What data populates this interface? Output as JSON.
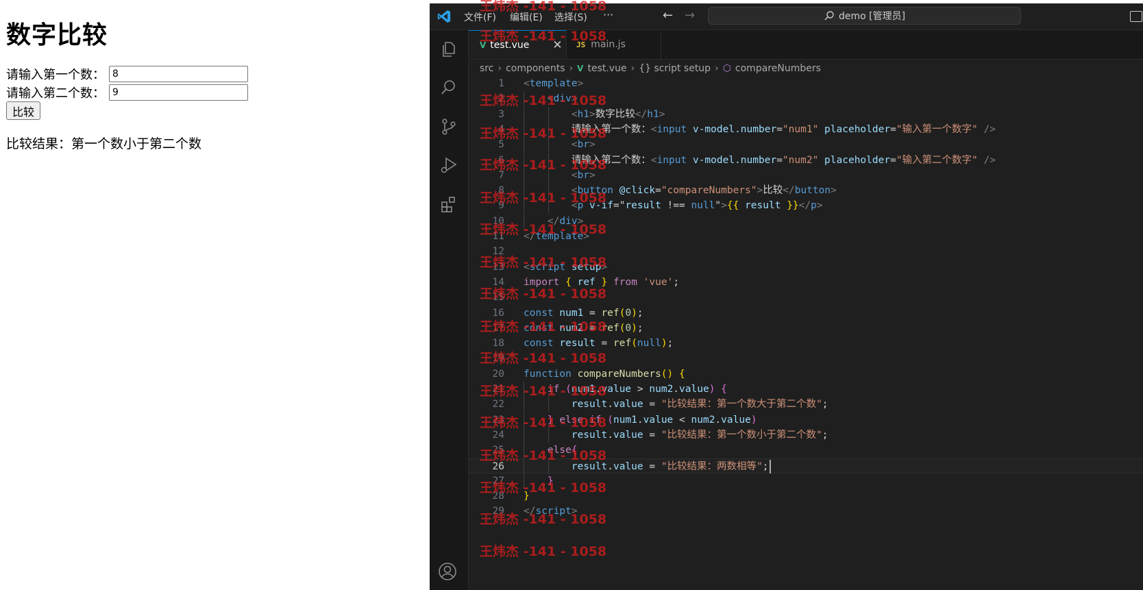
{
  "browser": {
    "heading": "数字比较",
    "input1_label": "请输入第一个数：",
    "input1_value": "8",
    "input2_label": "请输入第二个数：",
    "input2_value": "9",
    "button_label": "比较",
    "result": "比较结果：第一个数小于第二个数"
  },
  "vscode": {
    "menu": [
      "文件(F)",
      "编辑(E)",
      "选择(S)",
      "···"
    ],
    "command_center": "demo [管理员]",
    "tabs": [
      {
        "label": "test.vue",
        "icon": "vue-icon",
        "active": true
      },
      {
        "label": "main.js",
        "icon": "js-icon",
        "active": false
      }
    ],
    "breadcrumb": [
      "src",
      "components",
      "test.vue",
      "{} script setup",
      "compareNumbers"
    ],
    "current_line": 26,
    "watermark": "王炜杰 -141 - 1058",
    "accent_color": "#0078d4"
  },
  "code_lines": [
    [
      [
        "t-punc",
        "<"
      ],
      [
        "t-tag",
        "template"
      ],
      [
        "t-punc",
        ">"
      ]
    ],
    [
      [
        "",
        "    "
      ],
      [
        "t-punc",
        "<"
      ],
      [
        "t-tag",
        "div"
      ],
      [
        "t-punc",
        ">"
      ]
    ],
    [
      [
        "",
        "        "
      ],
      [
        "t-punc",
        "<"
      ],
      [
        "t-tag",
        "h1"
      ],
      [
        "t-punc",
        ">"
      ],
      [
        "t-txt",
        "数字比较"
      ],
      [
        "t-punc",
        "</"
      ],
      [
        "t-tag",
        "h1"
      ],
      [
        "t-punc",
        ">"
      ]
    ],
    [
      [
        "",
        "        "
      ],
      [
        "t-txt",
        "请输入第一个数："
      ],
      [
        "t-punc",
        "<"
      ],
      [
        "t-tag",
        "input"
      ],
      [
        "t-txt",
        " "
      ],
      [
        "t-attr",
        "v-model.number"
      ],
      [
        "t-txt",
        "="
      ],
      [
        "t-str",
        "\"num1\""
      ],
      [
        "t-txt",
        " "
      ],
      [
        "t-attr",
        "placeholder"
      ],
      [
        "t-txt",
        "="
      ],
      [
        "t-str",
        "\"输入第一个数字\""
      ],
      [
        "t-txt",
        " "
      ],
      [
        "t-punc",
        "/>"
      ]
    ],
    [
      [
        "",
        "        "
      ],
      [
        "t-punc",
        "<"
      ],
      [
        "t-tag",
        "br"
      ],
      [
        "t-punc",
        ">"
      ]
    ],
    [
      [
        "",
        "        "
      ],
      [
        "t-txt",
        "请输入第二个数："
      ],
      [
        "t-punc",
        "<"
      ],
      [
        "t-tag",
        "input"
      ],
      [
        "t-txt",
        " "
      ],
      [
        "t-attr",
        "v-model.number"
      ],
      [
        "t-txt",
        "="
      ],
      [
        "t-str",
        "\"num2\""
      ],
      [
        "t-txt",
        " "
      ],
      [
        "t-attr",
        "placeholder"
      ],
      [
        "t-txt",
        "="
      ],
      [
        "t-str",
        "\"输入第二个数字\""
      ],
      [
        "t-txt",
        " "
      ],
      [
        "t-punc",
        "/>"
      ]
    ],
    [
      [
        "",
        "        "
      ],
      [
        "t-punc",
        "<"
      ],
      [
        "t-tag",
        "br"
      ],
      [
        "t-punc",
        ">"
      ]
    ],
    [
      [
        "",
        "        "
      ],
      [
        "t-punc",
        "<"
      ],
      [
        "t-tag",
        "button"
      ],
      [
        "t-txt",
        " "
      ],
      [
        "t-attr",
        "@click"
      ],
      [
        "t-txt",
        "="
      ],
      [
        "t-str",
        "\"compareNumbers\""
      ],
      [
        "t-punc",
        ">"
      ],
      [
        "t-txt",
        "比较"
      ],
      [
        "t-punc",
        "</"
      ],
      [
        "t-tag",
        "button"
      ],
      [
        "t-punc",
        ">"
      ]
    ],
    [
      [
        "",
        "        "
      ],
      [
        "t-punc",
        "<"
      ],
      [
        "t-tag",
        "p"
      ],
      [
        "t-txt",
        " "
      ],
      [
        "t-attr",
        "v-if"
      ],
      [
        "t-txt",
        "="
      ],
      [
        "t-txt",
        "\""
      ],
      [
        "t-var",
        "result"
      ],
      [
        "t-txt",
        " !== "
      ],
      [
        "t-kw",
        "null"
      ],
      [
        "t-txt",
        "\""
      ],
      [
        "t-punc",
        ">"
      ],
      [
        "t-b1",
        "{{"
      ],
      [
        "t-txt",
        " "
      ],
      [
        "t-var",
        "result"
      ],
      [
        "t-txt",
        " "
      ],
      [
        "t-b1",
        "}}"
      ],
      [
        "t-punc",
        "</"
      ],
      [
        "t-tag",
        "p"
      ],
      [
        "t-punc",
        ">"
      ]
    ],
    [
      [
        "",
        "    "
      ],
      [
        "t-punc",
        "</"
      ],
      [
        "t-tag",
        "div"
      ],
      [
        "t-punc",
        ">"
      ]
    ],
    [
      [
        "t-punc",
        "</"
      ],
      [
        "t-tag",
        "template"
      ],
      [
        "t-punc",
        ">"
      ]
    ],
    [],
    [
      [
        "t-punc",
        "<"
      ],
      [
        "t-tag",
        "script"
      ],
      [
        "t-txt",
        " "
      ],
      [
        "t-attr",
        "setup"
      ],
      [
        "t-punc",
        ">"
      ]
    ],
    [
      [
        "t-ctrl",
        "import"
      ],
      [
        "t-txt",
        " "
      ],
      [
        "t-b1",
        "{"
      ],
      [
        "t-txt",
        " "
      ],
      [
        "t-var",
        "ref"
      ],
      [
        "t-txt",
        " "
      ],
      [
        "t-b1",
        "}"
      ],
      [
        "t-txt",
        " "
      ],
      [
        "t-ctrl",
        "from"
      ],
      [
        "t-txt",
        " "
      ],
      [
        "t-str",
        "'vue'"
      ],
      [
        "t-txt",
        ";"
      ]
    ],
    [],
    [
      [
        "t-kw",
        "const"
      ],
      [
        "t-txt",
        " "
      ],
      [
        "t-var",
        "num1"
      ],
      [
        "t-txt",
        " = "
      ],
      [
        "t-fn",
        "ref"
      ],
      [
        "t-b1",
        "("
      ],
      [
        "t-num",
        "0"
      ],
      [
        "t-b1",
        ")"
      ],
      [
        "t-txt",
        ";"
      ]
    ],
    [
      [
        "t-kw",
        "const"
      ],
      [
        "t-txt",
        " "
      ],
      [
        "t-var",
        "num2"
      ],
      [
        "t-txt",
        " = "
      ],
      [
        "t-fn",
        "ref"
      ],
      [
        "t-b1",
        "("
      ],
      [
        "t-num",
        "0"
      ],
      [
        "t-b1",
        ")"
      ],
      [
        "t-txt",
        ";"
      ]
    ],
    [
      [
        "t-kw",
        "const"
      ],
      [
        "t-txt",
        " "
      ],
      [
        "t-var",
        "result"
      ],
      [
        "t-txt",
        " = "
      ],
      [
        "t-fn",
        "ref"
      ],
      [
        "t-b1",
        "("
      ],
      [
        "t-kw",
        "null"
      ],
      [
        "t-b1",
        ")"
      ],
      [
        "t-txt",
        ";"
      ]
    ],
    [],
    [
      [
        "t-kw",
        "function"
      ],
      [
        "t-txt",
        " "
      ],
      [
        "t-fn",
        "compareNumbers"
      ],
      [
        "t-b1",
        "()"
      ],
      [
        "t-txt",
        " "
      ],
      [
        "t-b1",
        "{"
      ]
    ],
    [
      [
        "",
        "    "
      ],
      [
        "t-ctrl",
        "if"
      ],
      [
        "t-txt",
        " "
      ],
      [
        "t-b2",
        "("
      ],
      [
        "t-var",
        "num1"
      ],
      [
        "t-txt",
        "."
      ],
      [
        "t-var",
        "value"
      ],
      [
        "t-txt",
        " > "
      ],
      [
        "t-var",
        "num2"
      ],
      [
        "t-txt",
        "."
      ],
      [
        "t-var",
        "value"
      ],
      [
        "t-b2",
        ")"
      ],
      [
        "t-txt",
        " "
      ],
      [
        "t-b2",
        "{"
      ]
    ],
    [
      [
        "",
        "        "
      ],
      [
        "t-var",
        "result"
      ],
      [
        "t-txt",
        "."
      ],
      [
        "t-var",
        "value"
      ],
      [
        "t-txt",
        " = "
      ],
      [
        "t-str",
        "\"比较结果：第一个数大于第二个数\""
      ],
      [
        "t-txt",
        ";"
      ]
    ],
    [
      [
        "",
        "    "
      ],
      [
        "t-b2",
        "}"
      ],
      [
        "t-txt",
        " "
      ],
      [
        "t-ctrl",
        "else"
      ],
      [
        "t-txt",
        " "
      ],
      [
        "t-ctrl",
        "if"
      ],
      [
        "t-txt",
        " "
      ],
      [
        "t-b2",
        "("
      ],
      [
        "t-var",
        "num1"
      ],
      [
        "t-txt",
        "."
      ],
      [
        "t-var",
        "value"
      ],
      [
        "t-txt",
        " < "
      ],
      [
        "t-var",
        "num2"
      ],
      [
        "t-txt",
        "."
      ],
      [
        "t-var",
        "value"
      ],
      [
        "t-b2",
        ")"
      ]
    ],
    [
      [
        "",
        "        "
      ],
      [
        "t-var",
        "result"
      ],
      [
        "t-txt",
        "."
      ],
      [
        "t-var",
        "value"
      ],
      [
        "t-txt",
        " = "
      ],
      [
        "t-str",
        "\"比较结果：第一个数小于第二个数\""
      ],
      [
        "t-txt",
        ";"
      ]
    ],
    [
      [
        "",
        "    "
      ],
      [
        "t-ctrl",
        "else"
      ],
      [
        "t-b2",
        "{"
      ]
    ],
    [
      [
        "",
        "        "
      ],
      [
        "t-var",
        "result"
      ],
      [
        "t-txt",
        "."
      ],
      [
        "t-var",
        "value"
      ],
      [
        "t-txt",
        " = "
      ],
      [
        "t-str",
        "\"比较结果：两数相等\""
      ],
      [
        "t-txt",
        ";"
      ]
    ],
    [
      [
        "",
        "    "
      ],
      [
        "t-b2",
        "}"
      ]
    ],
    [
      [
        "t-b1",
        "}"
      ]
    ],
    [
      [
        "t-punc",
        "</"
      ],
      [
        "t-tag",
        "script"
      ],
      [
        "t-punc",
        ">"
      ]
    ]
  ]
}
